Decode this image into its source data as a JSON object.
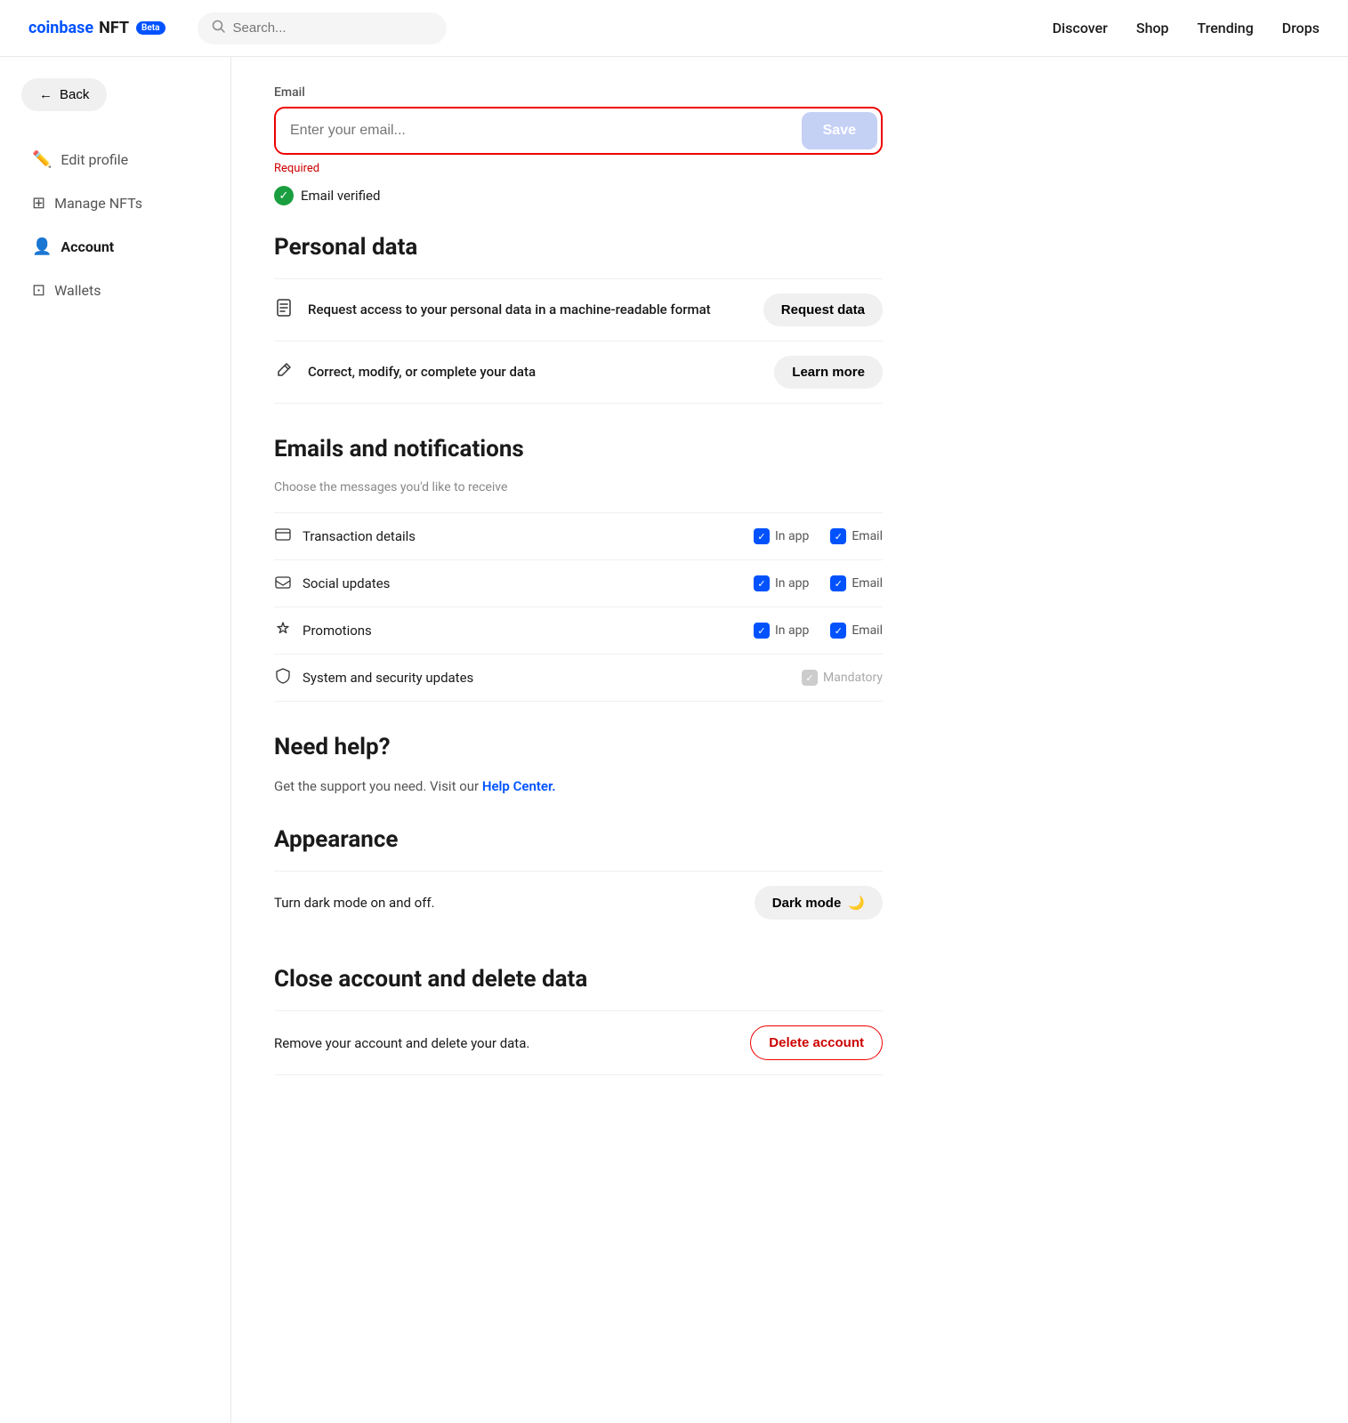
{
  "header": {
    "logo_coinbase": "coinbase",
    "logo_nft": "NFT",
    "beta_label": "Beta",
    "search_placeholder": "Search...",
    "nav": {
      "discover": "Discover",
      "shop": "Shop",
      "trending": "Trending",
      "drops": "Drops"
    }
  },
  "sidebar": {
    "back_label": "Back",
    "items": [
      {
        "id": "edit-profile",
        "label": "Edit profile",
        "icon": "✏️"
      },
      {
        "id": "manage-nfts",
        "label": "Manage NFTs",
        "icon": "⊞"
      },
      {
        "id": "account",
        "label": "Account",
        "icon": "👤"
      },
      {
        "id": "wallets",
        "label": "Wallets",
        "icon": "⊡"
      }
    ]
  },
  "email_section": {
    "label": "Email",
    "placeholder": "Enter your email...",
    "save_label": "Save",
    "required_text": "Required",
    "verified_text": "Email verified"
  },
  "personal_data": {
    "heading": "Personal data",
    "rows": [
      {
        "icon": "📄",
        "text": "Request access to your personal data in a machine-readable format",
        "action": "Request data"
      },
      {
        "icon": "✏",
        "text": "Correct, modify, or complete your data",
        "action": "Learn more"
      }
    ]
  },
  "notifications": {
    "heading": "Emails and notifications",
    "subtitle": "Choose the messages you'd like to receive",
    "items": [
      {
        "icon": "🖥",
        "label": "Transaction details",
        "in_app": true,
        "email": true,
        "mandatory": false
      },
      {
        "icon": "💬",
        "label": "Social updates",
        "in_app": true,
        "email": true,
        "mandatory": false
      },
      {
        "icon": "🏷",
        "label": "Promotions",
        "in_app": true,
        "email": true,
        "mandatory": false
      },
      {
        "icon": "🛡",
        "label": "System and security updates",
        "in_app": null,
        "email": null,
        "mandatory": true
      }
    ],
    "in_app_label": "In app",
    "email_label": "Email",
    "mandatory_label": "Mandatory"
  },
  "help": {
    "heading": "Need help?",
    "text": "Get the support you need. Visit our ",
    "link_text": "Help Center.",
    "link_url": "#"
  },
  "appearance": {
    "heading": "Appearance",
    "text": "Turn dark mode on and off.",
    "dark_mode_label": "Dark mode",
    "dark_mode_icon": "🌙"
  },
  "delete": {
    "heading": "Close account and delete data",
    "text": "Remove your account and delete your data.",
    "button_label": "Delete account"
  }
}
